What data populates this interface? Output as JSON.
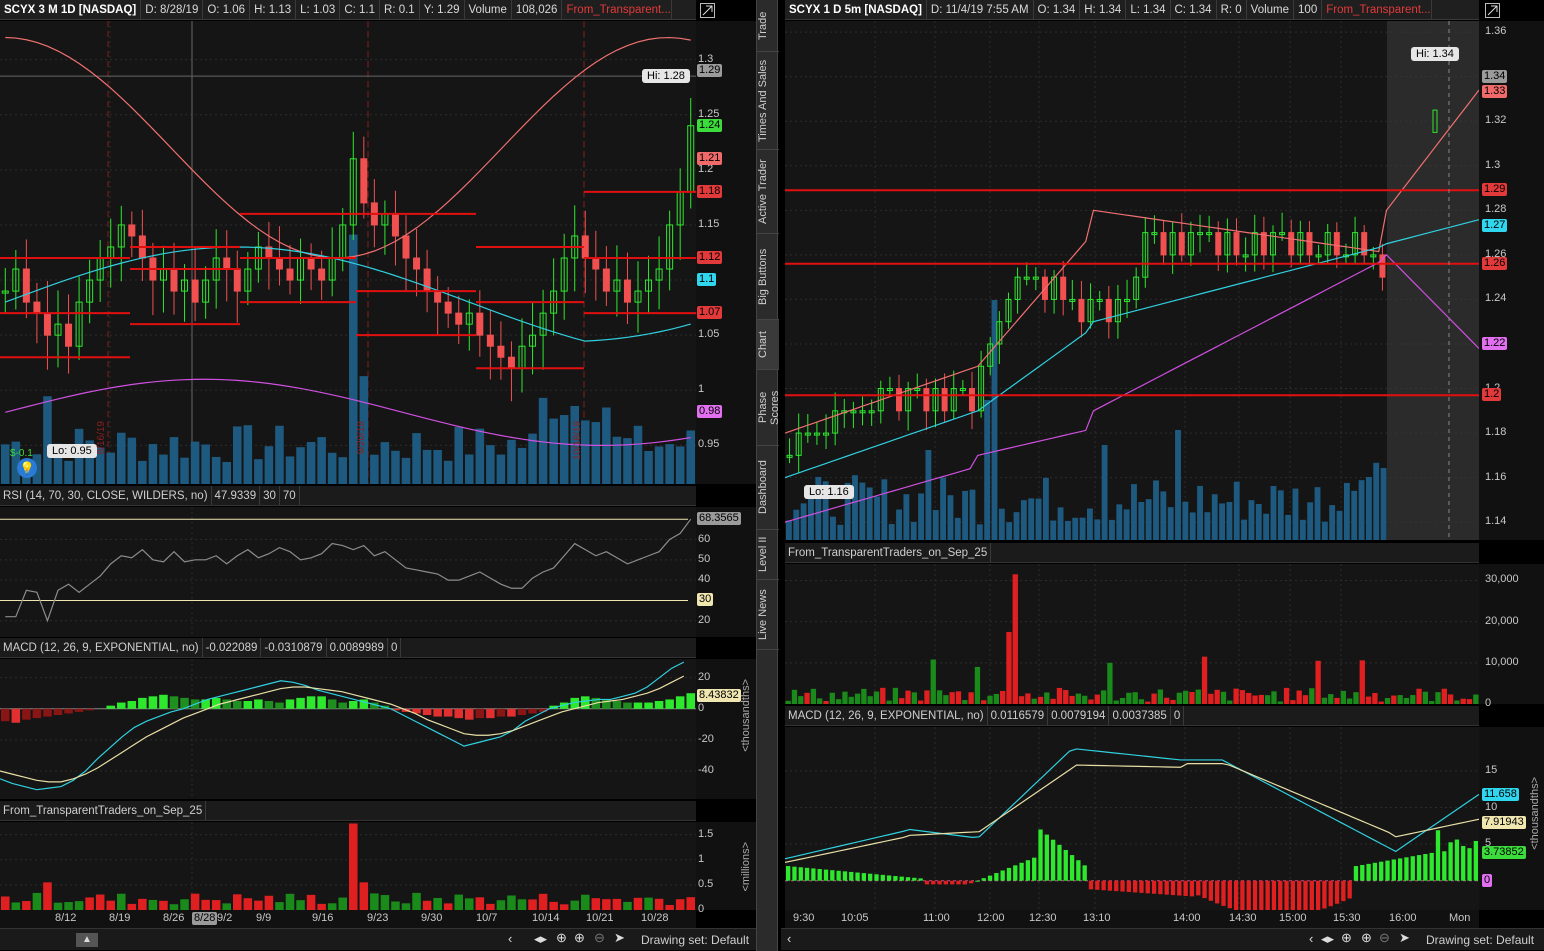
{
  "left": {
    "header": {
      "symbol": "SCYX 3 M 1D [NASDAQ]",
      "date": "D: 8/28/19",
      "open": "O: 1.06",
      "high": "H: 1.13",
      "low": "L: 1.03",
      "close": "C: 1.1",
      "range": "R: 0.1",
      "y": "Y: 1.29",
      "vol_label": "Volume",
      "vol_value": "108,026",
      "study": "From_Transparent..."
    },
    "price_axis": [
      "1.3",
      "1.25",
      "1.2",
      "1.15",
      "1.1",
      "1.05",
      "1",
      "0.95"
    ],
    "price_tags": [
      {
        "v": "1.29",
        "c": "#9b9b9b"
      },
      {
        "v": "1.24",
        "c": "#3bdc3b"
      },
      {
        "v": "1.21",
        "c": "#f06a6a"
      },
      {
        "v": "1.18",
        "c": "#e23a3a"
      },
      {
        "v": "1.12",
        "c": "#e23a3a"
      },
      {
        "v": "1.1",
        "c": "#2fd6ee"
      },
      {
        "v": "1.07",
        "c": "#e23a3a"
      },
      {
        "v": "0.98",
        "c": "#e070f0"
      }
    ],
    "hi_label": "Hi: 1.28",
    "lo_label": "Lo: 0.95",
    "dividend": "$-0.1",
    "event_dates": [
      "8/16/19",
      "9/20/19",
      "10/18/19"
    ],
    "rsi": {
      "label": "RSI (14, 70, 30, CLOSE, WILDERS, no)",
      "value": "47.9339",
      "ob": "30",
      "os": "70",
      "axis": [
        "60",
        "50",
        "40",
        "20"
      ],
      "tag": "68.3565",
      "tag30": "30"
    },
    "macd": {
      "label": "MACD (12, 26, 9, EXPONENTIAL, no)",
      "v1": "-0.022089",
      "v2": "-0.0310879",
      "v3": "0.0089989",
      "v4": "0",
      "axis": [
        "20",
        "0",
        "-20",
        "-40"
      ],
      "tag": "8.43832",
      "unit": "<thousandths>"
    },
    "vol": {
      "label": "From_TransparentTraders_on_Sep_25",
      "axis": [
        "1.5",
        "1",
        "0.5",
        "0"
      ],
      "unit": "<millions>"
    },
    "x_labels": [
      "8/12",
      "8/19",
      "8/26",
      "9/2",
      "9/9",
      "9/16",
      "9/23",
      "9/30",
      "10/7",
      "10/14",
      "10/21",
      "10/28"
    ],
    "cursor_date": "8/28",
    "drawing_set": "Drawing set: Default"
  },
  "right": {
    "header": {
      "symbol": "SCYX 1 D 5m [NASDAQ]",
      "date": "D: 11/4/19 7:55 AM",
      "open": "O: 1.34",
      "high": "H: 1.34",
      "low": "L: 1.34",
      "close": "C: 1.34",
      "range": "R: 0",
      "vol_label": "Volume",
      "vol_value": "100",
      "study": "From_Transparent..."
    },
    "price_axis": [
      "1.36",
      "1.34",
      "1.32",
      "1.3",
      "1.28",
      "1.26",
      "1.24",
      "1.22",
      "1.2",
      "1.18",
      "1.16",
      "1.14"
    ],
    "price_tags": [
      {
        "v": "1.34",
        "c": "#9b9b9b"
      },
      {
        "v": "1.33",
        "c": "#f06a6a"
      },
      {
        "v": "1.29",
        "c": "#e23a3a"
      },
      {
        "v": "1.27",
        "c": "#2fd6ee"
      },
      {
        "v": "1.26",
        "c": "#e23a3a"
      },
      {
        "v": "1.22",
        "c": "#e070f0"
      },
      {
        "v": "1.2",
        "c": "#e23a3a"
      }
    ],
    "hi_label": "Hi: 1.34",
    "lo_label": "Lo: 1.16",
    "vol": {
      "label": "From_TransparentTraders_on_Sep_25",
      "axis": [
        "30,000",
        "20,000",
        "10,000",
        "0"
      ]
    },
    "macd": {
      "label": "MACD (12, 26, 9, EXPONENTIAL, no)",
      "v1": "0.0116579",
      "v2": "0.0079194",
      "v3": "0.0037385",
      "v4": "0",
      "axis": [
        "15",
        "10",
        "5"
      ],
      "tag1": "11.658",
      "tag2": "7.91943",
      "tag3": "3.73852",
      "tag4": "0",
      "unit": "<thousandths>"
    },
    "x_labels": [
      "9:30",
      "10:05",
      "11:00",
      "12:00",
      "12:30",
      "13:10",
      "14:00",
      "14:30",
      "15:00",
      "15:30",
      "16:00",
      "Mon"
    ],
    "drawing_set": "Drawing set: Default"
  },
  "side_tabs": [
    "Trade",
    "Times And Sales",
    "Active Trader",
    "Big Buttons",
    "Chart",
    "Phase Scores",
    "Dashboard",
    "Level II",
    "Live News"
  ],
  "colors": {
    "up": "#2ee82e",
    "down": "#f05050",
    "level": "#e01010",
    "upper": "#f07070",
    "mid": "#30d0e0",
    "lower": "#d050e0",
    "volume": "#1e5a80"
  }
}
